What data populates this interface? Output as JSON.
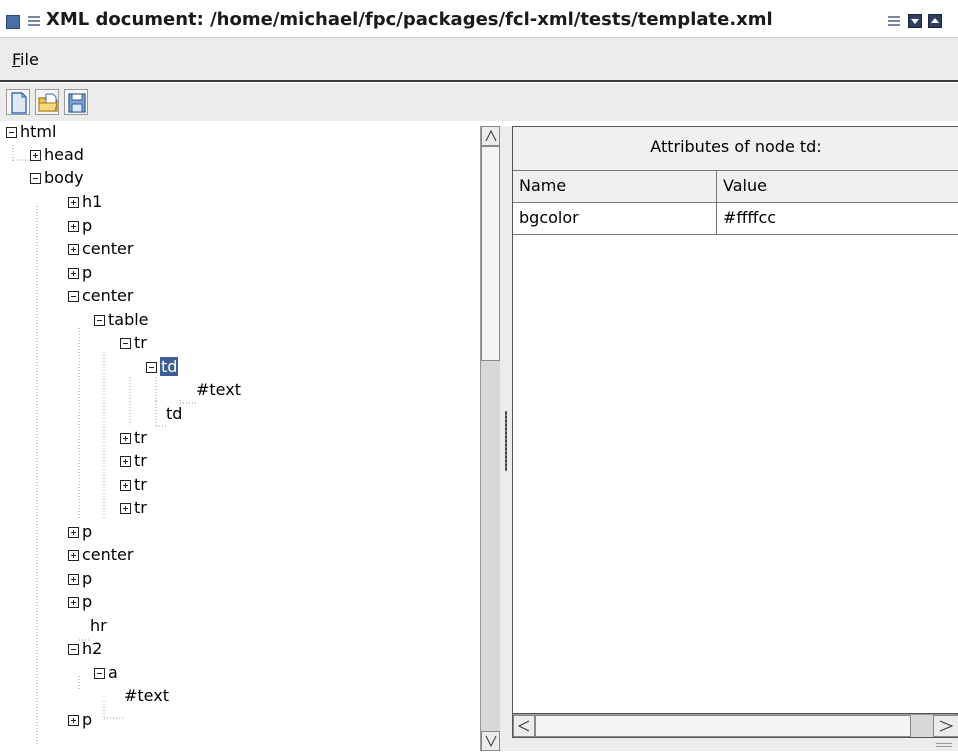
{
  "window": {
    "title": "XML document: /home/michael/fpc/packages/fcl-xml/tests/template.xml"
  },
  "menubar": {
    "file_label_mnemonic": "F",
    "file_label_rest": "ile"
  },
  "toolbar": {
    "buttons": [
      {
        "icon": "new-document-icon"
      },
      {
        "icon": "open-folder-icon"
      },
      {
        "icon": "save-disk-icon"
      }
    ]
  },
  "tree": {
    "nodes": [
      {
        "label": "html",
        "expander": "minus"
      },
      {
        "label": "head",
        "expander": "plus"
      },
      {
        "label": "body",
        "expander": "minus"
      },
      {
        "label": "h1",
        "expander": "plus"
      },
      {
        "label": "p",
        "expander": "plus"
      },
      {
        "label": "center",
        "expander": "plus"
      },
      {
        "label": "p",
        "expander": "plus"
      },
      {
        "label": "center",
        "expander": "minus"
      },
      {
        "label": "table",
        "expander": "minus"
      },
      {
        "label": "tr",
        "expander": "minus"
      },
      {
        "label": "td",
        "expander": "minus",
        "selected": true
      },
      {
        "label": "#text",
        "expander": "none"
      },
      {
        "label": "td",
        "expander": "none"
      },
      {
        "label": "tr",
        "expander": "plus"
      },
      {
        "label": "tr",
        "expander": "plus"
      },
      {
        "label": "tr",
        "expander": "plus"
      },
      {
        "label": "tr",
        "expander": "plus"
      },
      {
        "label": "p",
        "expander": "plus"
      },
      {
        "label": "center",
        "expander": "plus"
      },
      {
        "label": "p",
        "expander": "plus"
      },
      {
        "label": "p",
        "expander": "plus"
      },
      {
        "label": "hr",
        "expander": "none"
      },
      {
        "label": "h2",
        "expander": "minus"
      },
      {
        "label": "a",
        "expander": "minus"
      },
      {
        "label": "#text",
        "expander": "none"
      },
      {
        "label": "p",
        "expander": "plus"
      }
    ]
  },
  "attributes": {
    "title": "Attributes of node td:",
    "columns": [
      "Name",
      "Value"
    ],
    "rows": [
      {
        "name": "bgcolor",
        "value": "#ffffcc"
      }
    ]
  },
  "colors": {
    "selection": "#3d5f96",
    "title_icon": "#4a6fa5",
    "chrome": "#ececec"
  }
}
